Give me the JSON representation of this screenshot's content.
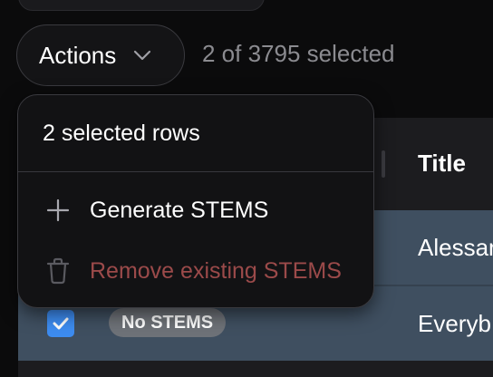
{
  "toolbar": {
    "actions_label": "Actions",
    "chevron_icon": "chevron-down-icon",
    "selection_text": "2 of 3795 selected"
  },
  "popup": {
    "header": "2 selected rows",
    "items": [
      {
        "label": "Generate STEMS",
        "icon": "plus-icon",
        "enabled": true
      },
      {
        "label": "Remove existing STEMS",
        "icon": "trash-icon",
        "enabled": false
      }
    ]
  },
  "table": {
    "columns": [
      "Title"
    ],
    "rows": [
      {
        "selected": true,
        "title": "Alessar"
      },
      {
        "selected": true,
        "stems_badge": "No STEMS",
        "title": "Everyb"
      }
    ]
  },
  "colors": {
    "background": "#0b0b0c",
    "checkbox_accent": "#3d8cf0",
    "selected_row": "#3f4f60",
    "destructive_disabled": "#9b4a4a"
  }
}
